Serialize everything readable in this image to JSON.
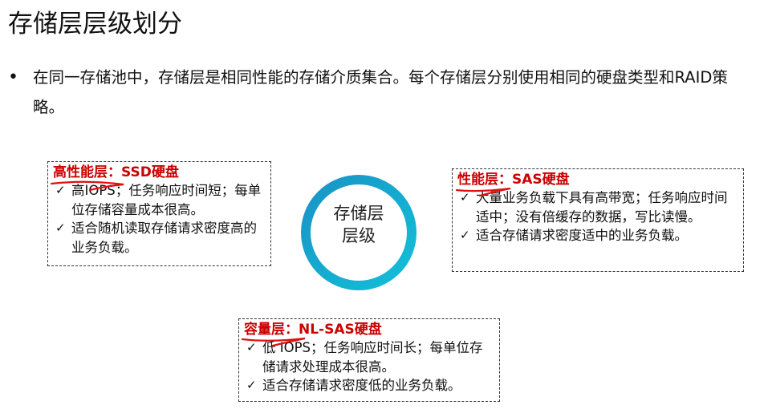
{
  "title": "存储层层级划分",
  "bullet": {
    "symbol": "•",
    "text": "在同一存储池中，存储层是相同性能的存储介质集合。每个存储层分别使用相同的硬盘类型和RAID策略。"
  },
  "center": {
    "line1": "存储层",
    "line2": "层级",
    "ring_color": "#1a93c6",
    "ring_gradient_end": "#12c0d8"
  },
  "tiers": {
    "high": {
      "title": "高性能层：SSD硬盘",
      "items": [
        "高IOPS；任务响应时间短；每单位存储容量成本很高。",
        "适合随机读取存储请求密度高的业务负载。"
      ]
    },
    "performance": {
      "title": "性能层：SAS硬盘",
      "items": [
        "大量业务负载下具有高带宽；任务响应时间适中；没有倍缓存的数据，写比读慢。",
        "适合存储请求密度适中的业务负载。"
      ]
    },
    "capacity": {
      "title": "容量层：NL-SAS硬盘",
      "items": [
        "低 IOPS；任务响应时间长；每单位存储请求处理成本很高。",
        "适合存储请求密度低的业务负载。"
      ]
    }
  },
  "colors": {
    "title_red": "#cc0000",
    "underline_red": "#dd1111"
  },
  "icons": {
    "check": "✓"
  }
}
